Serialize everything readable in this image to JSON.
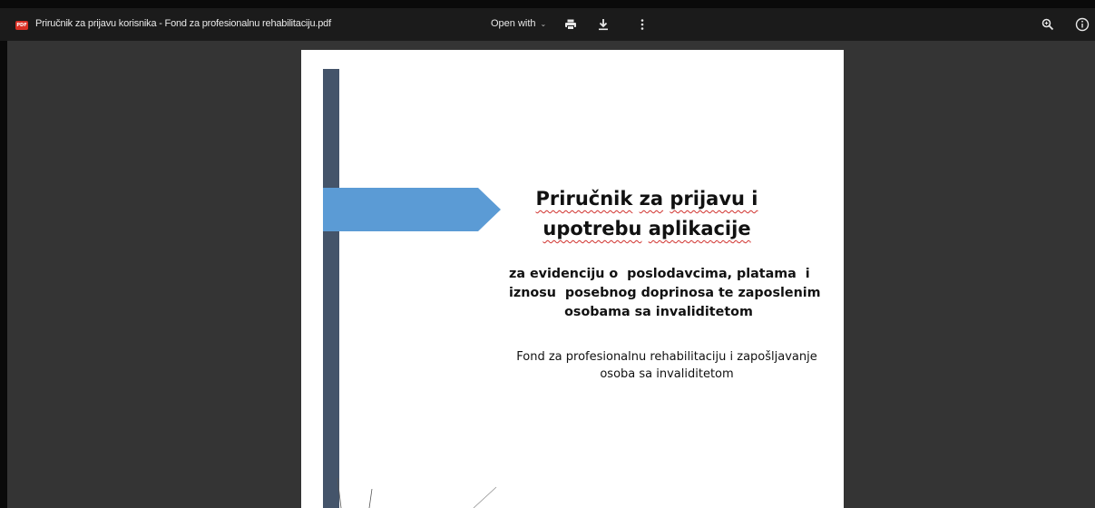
{
  "toolbar": {
    "file_badge": "PDF",
    "title": "Priručnik za prijavu korisnika - Fond za profesionalnu rehabilitaciju.pdf",
    "open_with_label": "Open with",
    "icons": [
      "pdf-file-icon",
      "chevron-down-icon",
      "print-icon",
      "download-icon",
      "more-vert-icon",
      "zoom-in-icon",
      "info-icon"
    ]
  },
  "document": {
    "title_line1": [
      "Priručnik",
      "za",
      "prijavu i"
    ],
    "title_line2": [
      "upotrebu",
      "aplikacije"
    ],
    "subtitle_line1": "za evidenciju o  poslodavcima, platama  i",
    "subtitle_line2": "iznosu  posebnog doprinosa te zaposlenim",
    "subtitle_line3": "osobama sa invaliditetom",
    "org_line1": "Fond za profesionalnu rehabilitaciju i zapošljavanje",
    "org_line2": "osoba sa invaliditetom"
  },
  "colors": {
    "topbar_bg": "#1b1b1b",
    "viewer_bg": "#343434",
    "side_bar": "#44546a",
    "arrow": "#5b9bd5",
    "badge": "#d93025"
  }
}
